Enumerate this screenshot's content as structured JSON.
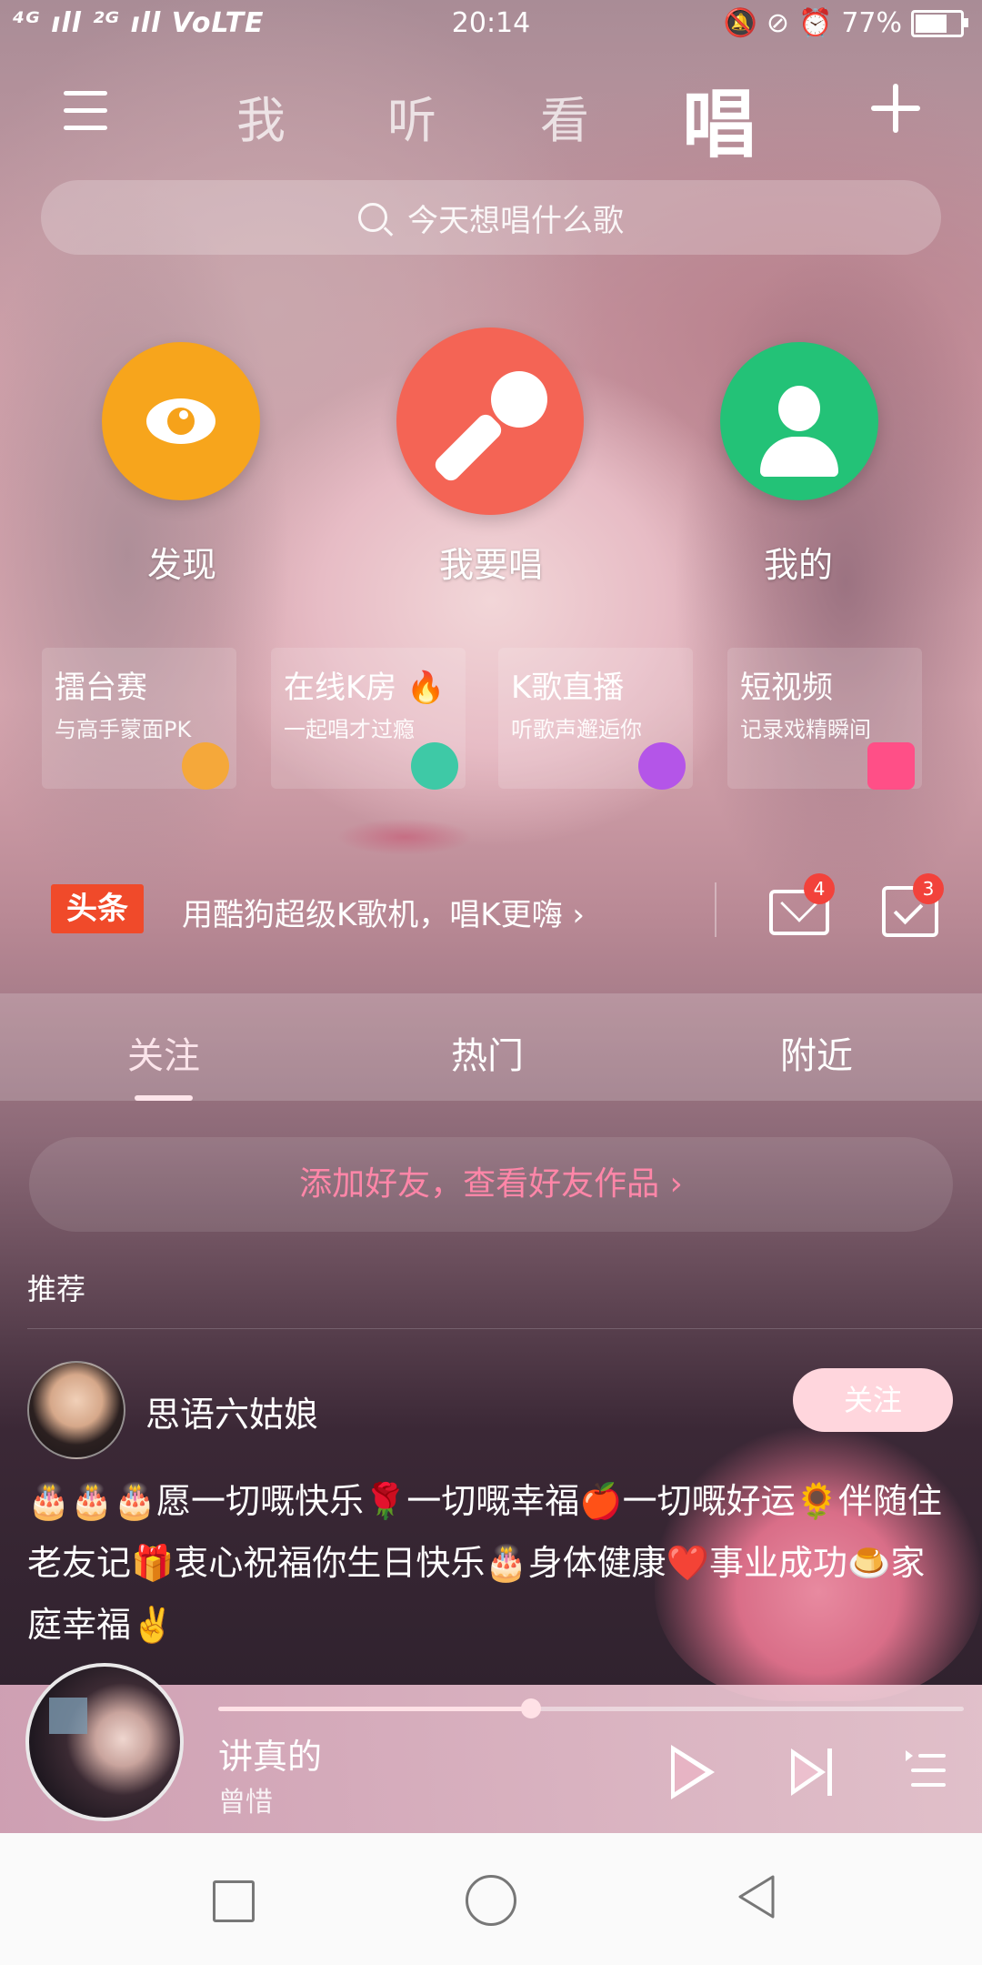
{
  "status_bar": {
    "network": "⁴ᴳ ıll ²ᴳ ıll VoLTE",
    "time": "20:14",
    "battery": "77%",
    "battery_level": 0.77
  },
  "top_nav": {
    "tabs": [
      "我",
      "听",
      "看",
      "唱"
    ],
    "active_tab": "唱"
  },
  "search": {
    "placeholder": "今天想唱什么歌"
  },
  "main_actions": [
    {
      "label": "发现",
      "icon": "eye-icon",
      "color": "#f7a51c"
    },
    {
      "label": "我要唱",
      "icon": "microphone-icon",
      "color": "#f46455"
    },
    {
      "label": "我的",
      "icon": "person-icon",
      "color": "#23c277"
    }
  ],
  "features": [
    {
      "title": "擂台赛",
      "subtitle": "与高手蒙面PK",
      "icon": "fist-icon",
      "color": "#f5a83a"
    },
    {
      "title": "在线K房 🔥",
      "subtitle": "一起唱才过瘾",
      "icon": "k-room-icon",
      "color": "#3ec9a6"
    },
    {
      "title": "K歌直播",
      "subtitle": "听歌声邂逅你",
      "icon": "live-icon",
      "color": "#b455e8"
    },
    {
      "title": "短视频",
      "subtitle": "记录戏精瞬间",
      "icon": "video-icon",
      "color": "#ff4f87"
    }
  ],
  "headline": {
    "badge": "头条",
    "text": "用酷狗超级K歌机，唱K更嗨 ›",
    "mail_count": "4",
    "task_count": "3"
  },
  "feed_tabs": [
    "关注",
    "热门",
    "附近"
  ],
  "active_feed_tab": "关注",
  "feed": {
    "add_friend": "添加好友，查看好友作品 ›",
    "recommend_label": "推荐",
    "post": {
      "username": "思语六姑娘",
      "follow_label": "关注",
      "text": "🎂🎂🎂愿一切嘅快乐🌹一切嘅幸福🍎一切嘅好运🌻伴随住老友记🎁衷心祝福你生日快乐🎂身体健康❤️事业成功🍮家庭幸福✌️"
    }
  },
  "player": {
    "song_title": "讲真的",
    "artist": "曾惜",
    "progress": 0.42
  },
  "colors": {
    "headline_badge": "#f04a2a",
    "accent_pink": "#ff86a8",
    "notification_badge": "#f2423b"
  }
}
